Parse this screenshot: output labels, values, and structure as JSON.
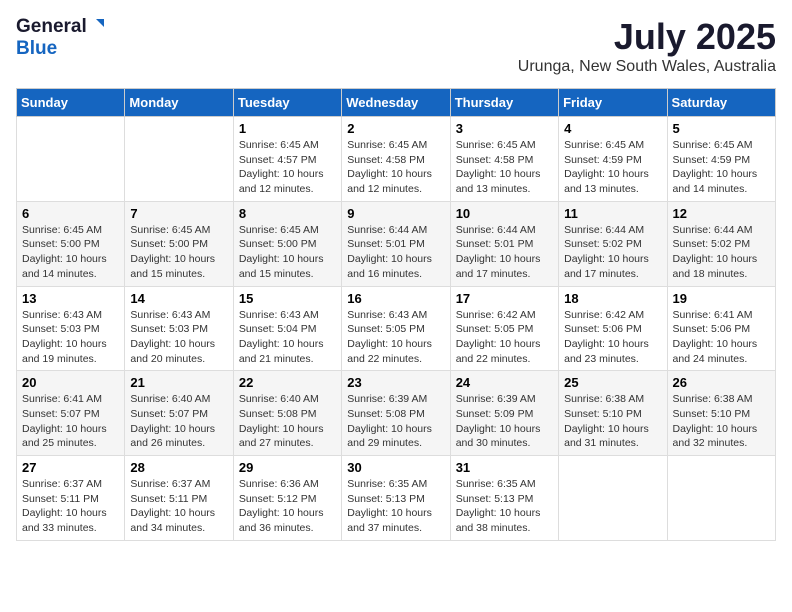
{
  "header": {
    "logo_general": "General",
    "logo_blue": "Blue",
    "month": "July 2025",
    "location": "Urunga, New South Wales, Australia"
  },
  "weekdays": [
    "Sunday",
    "Monday",
    "Tuesday",
    "Wednesday",
    "Thursday",
    "Friday",
    "Saturday"
  ],
  "weeks": [
    [
      {
        "day": "",
        "info": ""
      },
      {
        "day": "",
        "info": ""
      },
      {
        "day": "1",
        "info": "Sunrise: 6:45 AM\nSunset: 4:57 PM\nDaylight: 10 hours and 12 minutes."
      },
      {
        "day": "2",
        "info": "Sunrise: 6:45 AM\nSunset: 4:58 PM\nDaylight: 10 hours and 12 minutes."
      },
      {
        "day": "3",
        "info": "Sunrise: 6:45 AM\nSunset: 4:58 PM\nDaylight: 10 hours and 13 minutes."
      },
      {
        "day": "4",
        "info": "Sunrise: 6:45 AM\nSunset: 4:59 PM\nDaylight: 10 hours and 13 minutes."
      },
      {
        "day": "5",
        "info": "Sunrise: 6:45 AM\nSunset: 4:59 PM\nDaylight: 10 hours and 14 minutes."
      }
    ],
    [
      {
        "day": "6",
        "info": "Sunrise: 6:45 AM\nSunset: 5:00 PM\nDaylight: 10 hours and 14 minutes."
      },
      {
        "day": "7",
        "info": "Sunrise: 6:45 AM\nSunset: 5:00 PM\nDaylight: 10 hours and 15 minutes."
      },
      {
        "day": "8",
        "info": "Sunrise: 6:45 AM\nSunset: 5:00 PM\nDaylight: 10 hours and 15 minutes."
      },
      {
        "day": "9",
        "info": "Sunrise: 6:44 AM\nSunset: 5:01 PM\nDaylight: 10 hours and 16 minutes."
      },
      {
        "day": "10",
        "info": "Sunrise: 6:44 AM\nSunset: 5:01 PM\nDaylight: 10 hours and 17 minutes."
      },
      {
        "day": "11",
        "info": "Sunrise: 6:44 AM\nSunset: 5:02 PM\nDaylight: 10 hours and 17 minutes."
      },
      {
        "day": "12",
        "info": "Sunrise: 6:44 AM\nSunset: 5:02 PM\nDaylight: 10 hours and 18 minutes."
      }
    ],
    [
      {
        "day": "13",
        "info": "Sunrise: 6:43 AM\nSunset: 5:03 PM\nDaylight: 10 hours and 19 minutes."
      },
      {
        "day": "14",
        "info": "Sunrise: 6:43 AM\nSunset: 5:03 PM\nDaylight: 10 hours and 20 minutes."
      },
      {
        "day": "15",
        "info": "Sunrise: 6:43 AM\nSunset: 5:04 PM\nDaylight: 10 hours and 21 minutes."
      },
      {
        "day": "16",
        "info": "Sunrise: 6:43 AM\nSunset: 5:05 PM\nDaylight: 10 hours and 22 minutes."
      },
      {
        "day": "17",
        "info": "Sunrise: 6:42 AM\nSunset: 5:05 PM\nDaylight: 10 hours and 22 minutes."
      },
      {
        "day": "18",
        "info": "Sunrise: 6:42 AM\nSunset: 5:06 PM\nDaylight: 10 hours and 23 minutes."
      },
      {
        "day": "19",
        "info": "Sunrise: 6:41 AM\nSunset: 5:06 PM\nDaylight: 10 hours and 24 minutes."
      }
    ],
    [
      {
        "day": "20",
        "info": "Sunrise: 6:41 AM\nSunset: 5:07 PM\nDaylight: 10 hours and 25 minutes."
      },
      {
        "day": "21",
        "info": "Sunrise: 6:40 AM\nSunset: 5:07 PM\nDaylight: 10 hours and 26 minutes."
      },
      {
        "day": "22",
        "info": "Sunrise: 6:40 AM\nSunset: 5:08 PM\nDaylight: 10 hours and 27 minutes."
      },
      {
        "day": "23",
        "info": "Sunrise: 6:39 AM\nSunset: 5:08 PM\nDaylight: 10 hours and 29 minutes."
      },
      {
        "day": "24",
        "info": "Sunrise: 6:39 AM\nSunset: 5:09 PM\nDaylight: 10 hours and 30 minutes."
      },
      {
        "day": "25",
        "info": "Sunrise: 6:38 AM\nSunset: 5:10 PM\nDaylight: 10 hours and 31 minutes."
      },
      {
        "day": "26",
        "info": "Sunrise: 6:38 AM\nSunset: 5:10 PM\nDaylight: 10 hours and 32 minutes."
      }
    ],
    [
      {
        "day": "27",
        "info": "Sunrise: 6:37 AM\nSunset: 5:11 PM\nDaylight: 10 hours and 33 minutes."
      },
      {
        "day": "28",
        "info": "Sunrise: 6:37 AM\nSunset: 5:11 PM\nDaylight: 10 hours and 34 minutes."
      },
      {
        "day": "29",
        "info": "Sunrise: 6:36 AM\nSunset: 5:12 PM\nDaylight: 10 hours and 36 minutes."
      },
      {
        "day": "30",
        "info": "Sunrise: 6:35 AM\nSunset: 5:13 PM\nDaylight: 10 hours and 37 minutes."
      },
      {
        "day": "31",
        "info": "Sunrise: 6:35 AM\nSunset: 5:13 PM\nDaylight: 10 hours and 38 minutes."
      },
      {
        "day": "",
        "info": ""
      },
      {
        "day": "",
        "info": ""
      }
    ]
  ]
}
